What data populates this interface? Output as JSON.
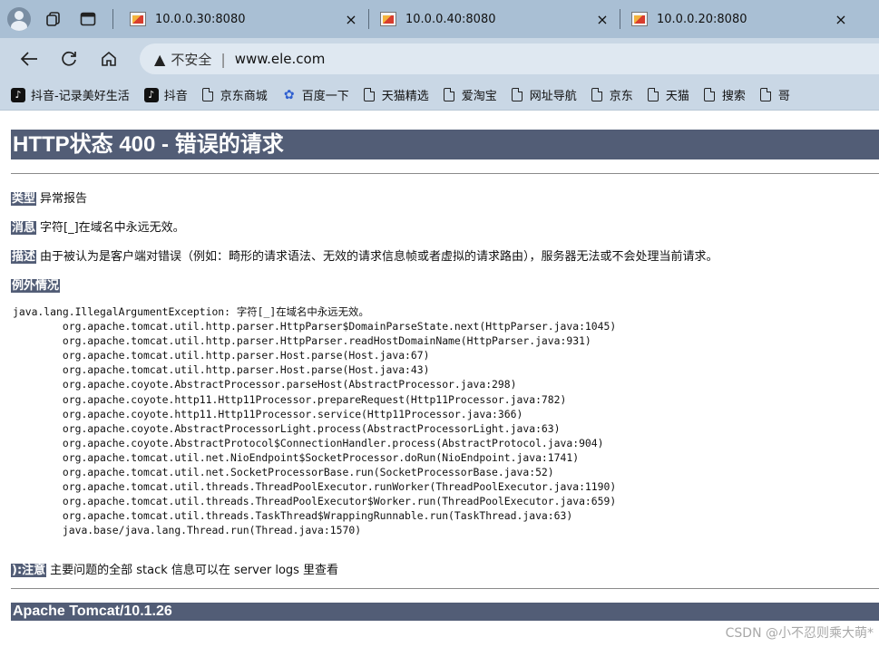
{
  "tabs": [
    {
      "title": "10.0.0.30:8080",
      "active": true
    },
    {
      "title": "10.0.0.40:8080",
      "active": false
    },
    {
      "title": "10.0.0.20:8080",
      "active": false
    }
  ],
  "tab_close_glyph": "×",
  "address": {
    "security_label": "不安全",
    "separator": "|",
    "url": "www.ele.com"
  },
  "bookmarks": [
    {
      "label": "抖音-记录美好生活",
      "icon": "tiktok-icon"
    },
    {
      "label": "抖音",
      "icon": "tiktok-icon"
    },
    {
      "label": "京东商城",
      "icon": "page-icon"
    },
    {
      "label": "百度一下",
      "icon": "baidu-paw-icon"
    },
    {
      "label": "天猫精选",
      "icon": "page-icon"
    },
    {
      "label": "爱淘宝",
      "icon": "page-icon"
    },
    {
      "label": "网址导航",
      "icon": "page-icon"
    },
    {
      "label": "京东",
      "icon": "page-icon"
    },
    {
      "label": "天猫",
      "icon": "page-icon"
    },
    {
      "label": "搜索",
      "icon": "page-icon"
    },
    {
      "label": "哥",
      "icon": "page-icon"
    }
  ],
  "page": {
    "heading": "HTTP状态 400 - 错误的请求",
    "type_label": "类型",
    "type_value": "异常报告",
    "message_label": "消息",
    "message_value": "字符[_]在域名中永远无效。",
    "description_label": "描述",
    "description_value": "由于被认为是客户端对错误（例如：畸形的请求语法、无效的请求信息帧或者虚拟的请求路由），服务器无法或不会处理当前请求。",
    "exception_label": "例外情况",
    "stack_trace": [
      "java.lang.IllegalArgumentException: 字符[_]在域名中永远无效。",
      "\torg.apache.tomcat.util.http.parser.HttpParser$DomainParseState.next(HttpParser.java:1045)",
      "\torg.apache.tomcat.util.http.parser.HttpParser.readHostDomainName(HttpParser.java:931)",
      "\torg.apache.tomcat.util.http.parser.Host.parse(Host.java:67)",
      "\torg.apache.tomcat.util.http.parser.Host.parse(Host.java:43)",
      "\torg.apache.coyote.AbstractProcessor.parseHost(AbstractProcessor.java:298)",
      "\torg.apache.coyote.http11.Http11Processor.prepareRequest(Http11Processor.java:782)",
      "\torg.apache.coyote.http11.Http11Processor.service(Http11Processor.java:366)",
      "\torg.apache.coyote.AbstractProcessorLight.process(AbstractProcessorLight.java:63)",
      "\torg.apache.coyote.AbstractProtocol$ConnectionHandler.process(AbstractProtocol.java:904)",
      "\torg.apache.tomcat.util.net.NioEndpoint$SocketProcessor.doRun(NioEndpoint.java:1741)",
      "\torg.apache.tomcat.util.net.SocketProcessorBase.run(SocketProcessorBase.java:52)",
      "\torg.apache.tomcat.util.threads.ThreadPoolExecutor.runWorker(ThreadPoolExecutor.java:1190)",
      "\torg.apache.tomcat.util.threads.ThreadPoolExecutor$Worker.run(ThreadPoolExecutor.java:659)",
      "\torg.apache.tomcat.util.threads.TaskThread$WrappingRunnable.run(TaskThread.java:63)",
      "\tjava.base/java.lang.Thread.run(Thread.java:1570)"
    ],
    "note_label": "):注意",
    "note_value": "主要问题的全部 stack 信息可以在 server logs 里查看",
    "footer": "Apache Tomcat/10.1.26"
  },
  "watermark": "CSDN @小不忍则乘大萌*",
  "colors": {
    "tomcat_header": "#525d76",
    "tab_strip": "#a9bfd4",
    "toolbar": "#c9d7e5"
  }
}
